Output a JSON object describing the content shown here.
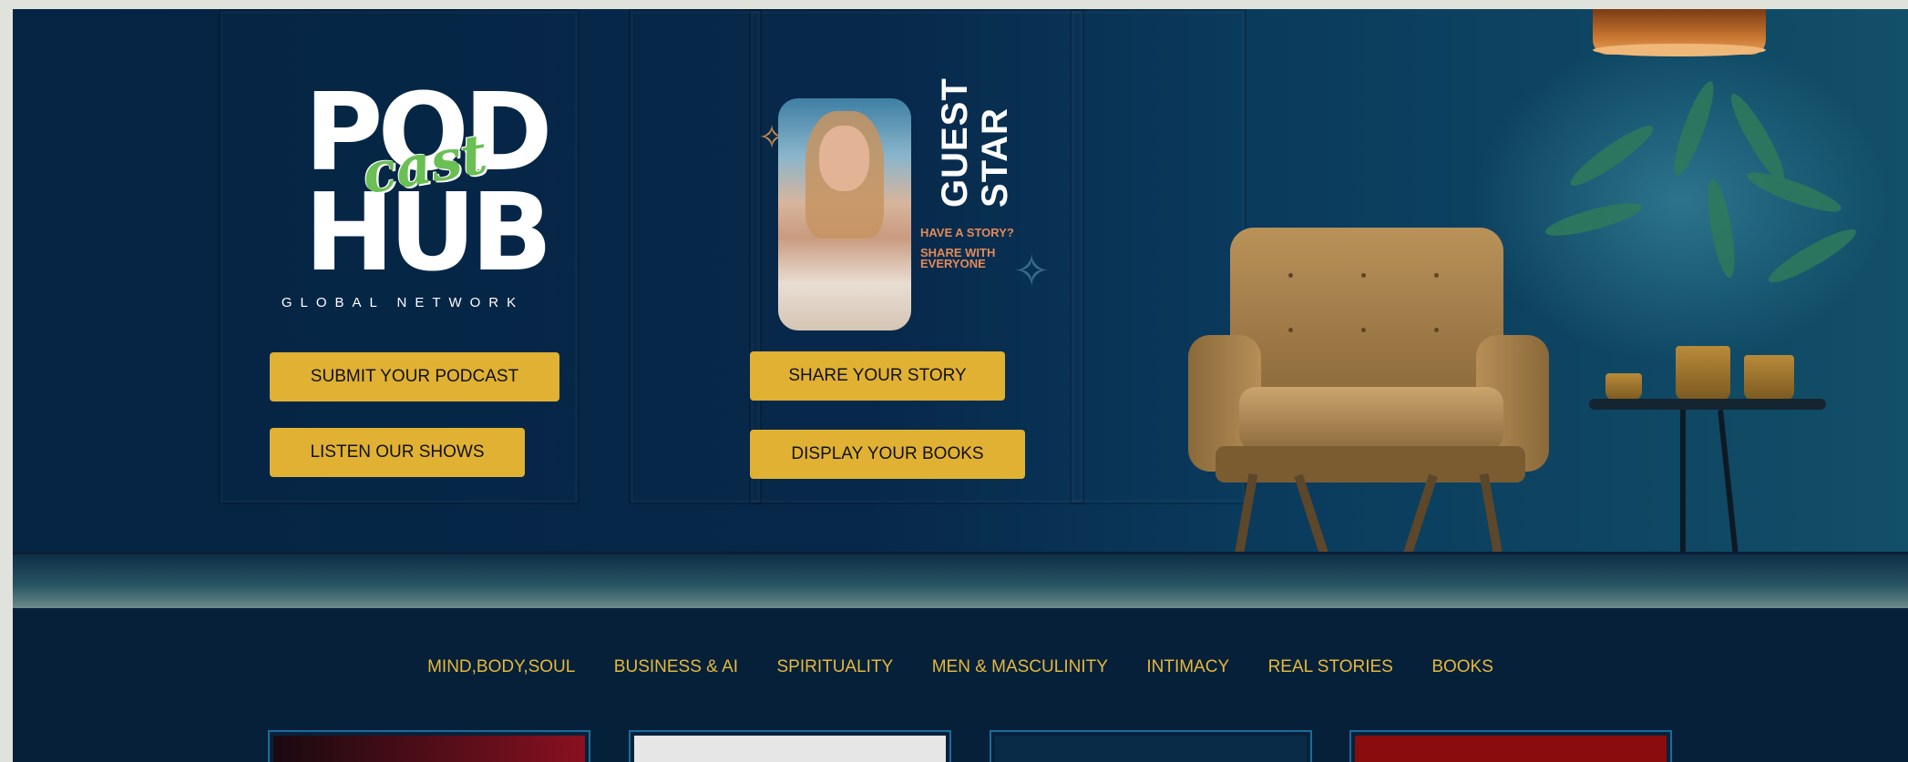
{
  "hero": {
    "logo": {
      "word_top": "POD",
      "word_script": "cast",
      "word_bottom": "HUB",
      "subtitle": "GLOBAL NETWORK",
      "script_color": "#6abf55"
    },
    "guest_card": {
      "title_line1": "GUEST",
      "title_line2": "STAR",
      "tagline1": "HAVE A STORY?",
      "tagline2": "SHARE WITH EVERYONE",
      "tagline_color": "#e58a57"
    },
    "buttons": {
      "submit_podcast": "SUBMIT YOUR PODCAST",
      "listen_shows": "LISTEN OUR SHOWS",
      "share_story": "SHARE YOUR STORY",
      "display_books": "DISPLAY YOUR BOOKS",
      "button_color": "#e0b133"
    }
  },
  "nav": {
    "items": [
      "MIND,BODY,SOUL",
      "BUSINESS & AI",
      "SPIRITUALITY",
      "MEN & MASCULINITY",
      "INTIMACY",
      "REAL STORIES",
      "BOOKS"
    ],
    "color": "#e6b83a"
  },
  "colors": {
    "background": "#06203a",
    "card_border": "#1a6d9a"
  }
}
